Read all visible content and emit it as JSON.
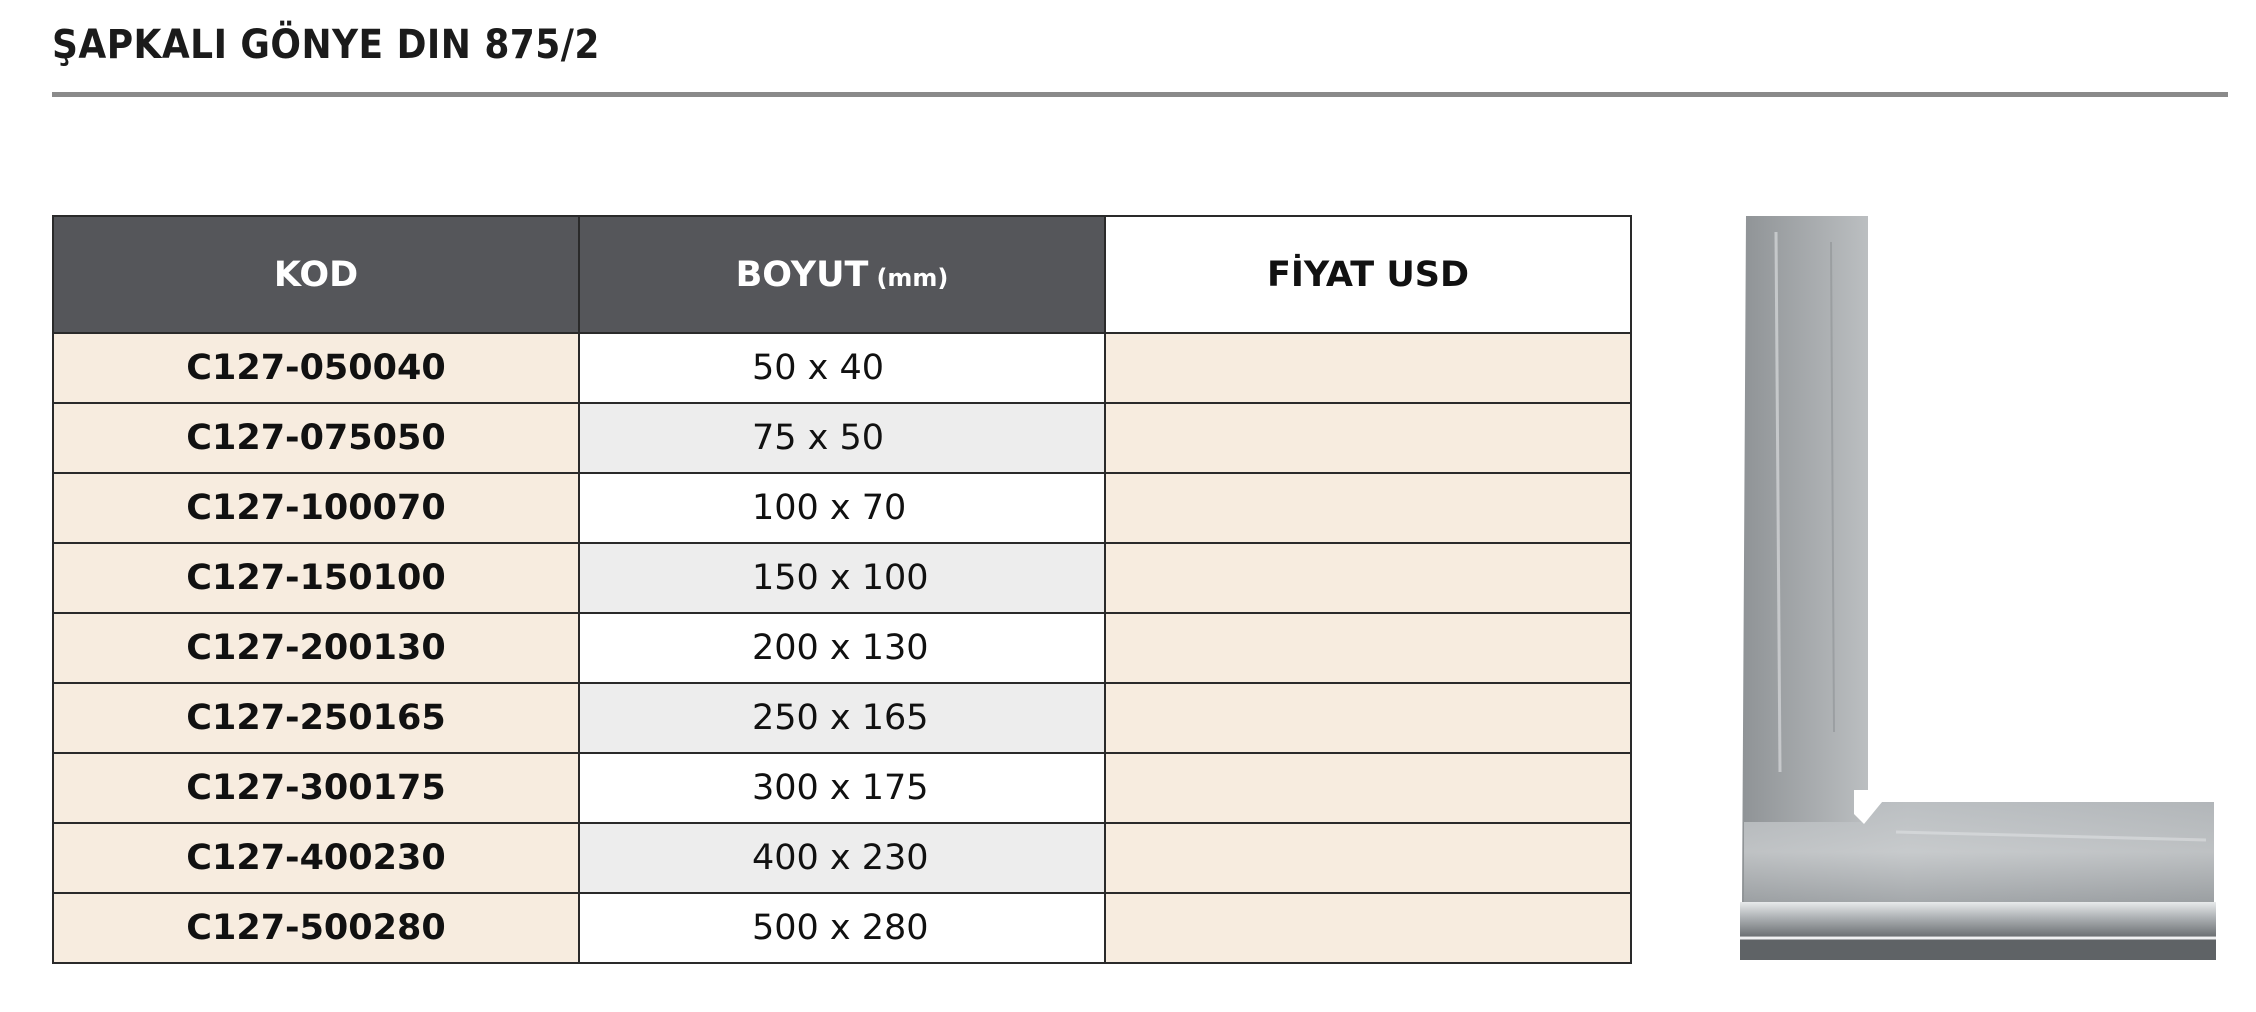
{
  "document": {
    "title": "ŞAPKALI GÖNYE DIN 875/2"
  },
  "table": {
    "headers": {
      "code": "KOD",
      "size": "BOYUT",
      "size_unit": "(mm)",
      "price": "FİYAT USD"
    },
    "rows": [
      {
        "code": "C127-050040",
        "size": "50 x 40",
        "price": ""
      },
      {
        "code": "C127-075050",
        "size": "75 x 50",
        "price": ""
      },
      {
        "code": "C127-100070",
        "size": "100 x 70",
        "price": ""
      },
      {
        "code": "C127-150100",
        "size": "150 x 100",
        "price": ""
      },
      {
        "code": "C127-200130",
        "size": "200 x 130",
        "price": ""
      },
      {
        "code": "C127-250165",
        "size": "250 x 165",
        "price": ""
      },
      {
        "code": "C127-300175",
        "size": "300 x 175",
        "price": ""
      },
      {
        "code": "C127-400230",
        "size": "400 x 230",
        "price": ""
      },
      {
        "code": "C127-500280",
        "size": "500 x 280",
        "price": ""
      }
    ]
  },
  "colors": {
    "header_dark": "#55565a",
    "code_cell": "#f7ecdf",
    "alt_row": "#ededed",
    "rule": "#8a8a8a"
  },
  "image": {
    "subject": "flat-steel-square-with-stock"
  }
}
